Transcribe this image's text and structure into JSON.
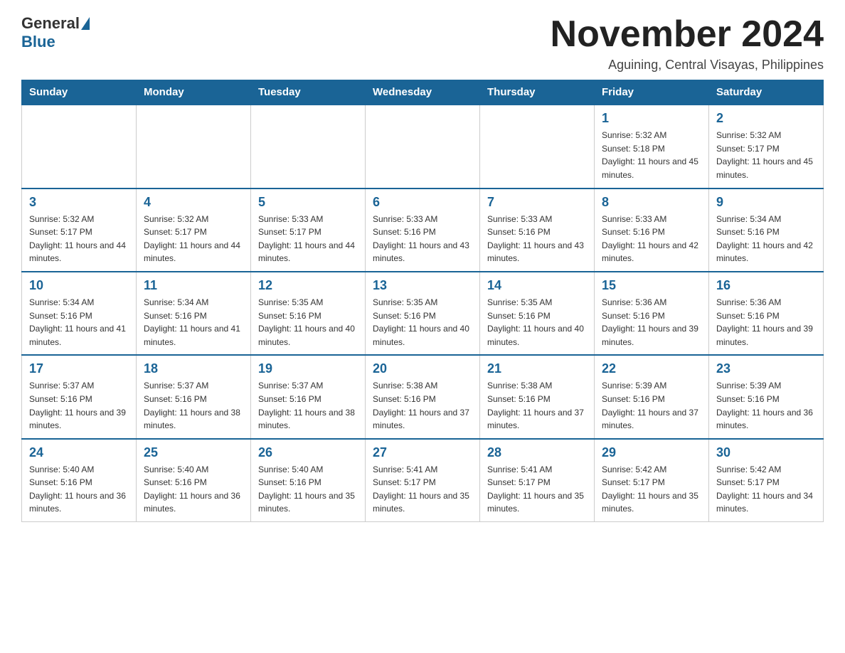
{
  "header": {
    "logo_general": "General",
    "logo_blue": "Blue",
    "month_title": "November 2024",
    "location": "Aguining, Central Visayas, Philippines"
  },
  "weekdays": [
    "Sunday",
    "Monday",
    "Tuesday",
    "Wednesday",
    "Thursday",
    "Friday",
    "Saturday"
  ],
  "weeks": [
    [
      {
        "day": "",
        "info": ""
      },
      {
        "day": "",
        "info": ""
      },
      {
        "day": "",
        "info": ""
      },
      {
        "day": "",
        "info": ""
      },
      {
        "day": "",
        "info": ""
      },
      {
        "day": "1",
        "info": "Sunrise: 5:32 AM\nSunset: 5:18 PM\nDaylight: 11 hours and 45 minutes."
      },
      {
        "day": "2",
        "info": "Sunrise: 5:32 AM\nSunset: 5:17 PM\nDaylight: 11 hours and 45 minutes."
      }
    ],
    [
      {
        "day": "3",
        "info": "Sunrise: 5:32 AM\nSunset: 5:17 PM\nDaylight: 11 hours and 44 minutes."
      },
      {
        "day": "4",
        "info": "Sunrise: 5:32 AM\nSunset: 5:17 PM\nDaylight: 11 hours and 44 minutes."
      },
      {
        "day": "5",
        "info": "Sunrise: 5:33 AM\nSunset: 5:17 PM\nDaylight: 11 hours and 44 minutes."
      },
      {
        "day": "6",
        "info": "Sunrise: 5:33 AM\nSunset: 5:16 PM\nDaylight: 11 hours and 43 minutes."
      },
      {
        "day": "7",
        "info": "Sunrise: 5:33 AM\nSunset: 5:16 PM\nDaylight: 11 hours and 43 minutes."
      },
      {
        "day": "8",
        "info": "Sunrise: 5:33 AM\nSunset: 5:16 PM\nDaylight: 11 hours and 42 minutes."
      },
      {
        "day": "9",
        "info": "Sunrise: 5:34 AM\nSunset: 5:16 PM\nDaylight: 11 hours and 42 minutes."
      }
    ],
    [
      {
        "day": "10",
        "info": "Sunrise: 5:34 AM\nSunset: 5:16 PM\nDaylight: 11 hours and 41 minutes."
      },
      {
        "day": "11",
        "info": "Sunrise: 5:34 AM\nSunset: 5:16 PM\nDaylight: 11 hours and 41 minutes."
      },
      {
        "day": "12",
        "info": "Sunrise: 5:35 AM\nSunset: 5:16 PM\nDaylight: 11 hours and 40 minutes."
      },
      {
        "day": "13",
        "info": "Sunrise: 5:35 AM\nSunset: 5:16 PM\nDaylight: 11 hours and 40 minutes."
      },
      {
        "day": "14",
        "info": "Sunrise: 5:35 AM\nSunset: 5:16 PM\nDaylight: 11 hours and 40 minutes."
      },
      {
        "day": "15",
        "info": "Sunrise: 5:36 AM\nSunset: 5:16 PM\nDaylight: 11 hours and 39 minutes."
      },
      {
        "day": "16",
        "info": "Sunrise: 5:36 AM\nSunset: 5:16 PM\nDaylight: 11 hours and 39 minutes."
      }
    ],
    [
      {
        "day": "17",
        "info": "Sunrise: 5:37 AM\nSunset: 5:16 PM\nDaylight: 11 hours and 39 minutes."
      },
      {
        "day": "18",
        "info": "Sunrise: 5:37 AM\nSunset: 5:16 PM\nDaylight: 11 hours and 38 minutes."
      },
      {
        "day": "19",
        "info": "Sunrise: 5:37 AM\nSunset: 5:16 PM\nDaylight: 11 hours and 38 minutes."
      },
      {
        "day": "20",
        "info": "Sunrise: 5:38 AM\nSunset: 5:16 PM\nDaylight: 11 hours and 37 minutes."
      },
      {
        "day": "21",
        "info": "Sunrise: 5:38 AM\nSunset: 5:16 PM\nDaylight: 11 hours and 37 minutes."
      },
      {
        "day": "22",
        "info": "Sunrise: 5:39 AM\nSunset: 5:16 PM\nDaylight: 11 hours and 37 minutes."
      },
      {
        "day": "23",
        "info": "Sunrise: 5:39 AM\nSunset: 5:16 PM\nDaylight: 11 hours and 36 minutes."
      }
    ],
    [
      {
        "day": "24",
        "info": "Sunrise: 5:40 AM\nSunset: 5:16 PM\nDaylight: 11 hours and 36 minutes."
      },
      {
        "day": "25",
        "info": "Sunrise: 5:40 AM\nSunset: 5:16 PM\nDaylight: 11 hours and 36 minutes."
      },
      {
        "day": "26",
        "info": "Sunrise: 5:40 AM\nSunset: 5:16 PM\nDaylight: 11 hours and 35 minutes."
      },
      {
        "day": "27",
        "info": "Sunrise: 5:41 AM\nSunset: 5:17 PM\nDaylight: 11 hours and 35 minutes."
      },
      {
        "day": "28",
        "info": "Sunrise: 5:41 AM\nSunset: 5:17 PM\nDaylight: 11 hours and 35 minutes."
      },
      {
        "day": "29",
        "info": "Sunrise: 5:42 AM\nSunset: 5:17 PM\nDaylight: 11 hours and 35 minutes."
      },
      {
        "day": "30",
        "info": "Sunrise: 5:42 AM\nSunset: 5:17 PM\nDaylight: 11 hours and 34 minutes."
      }
    ]
  ]
}
